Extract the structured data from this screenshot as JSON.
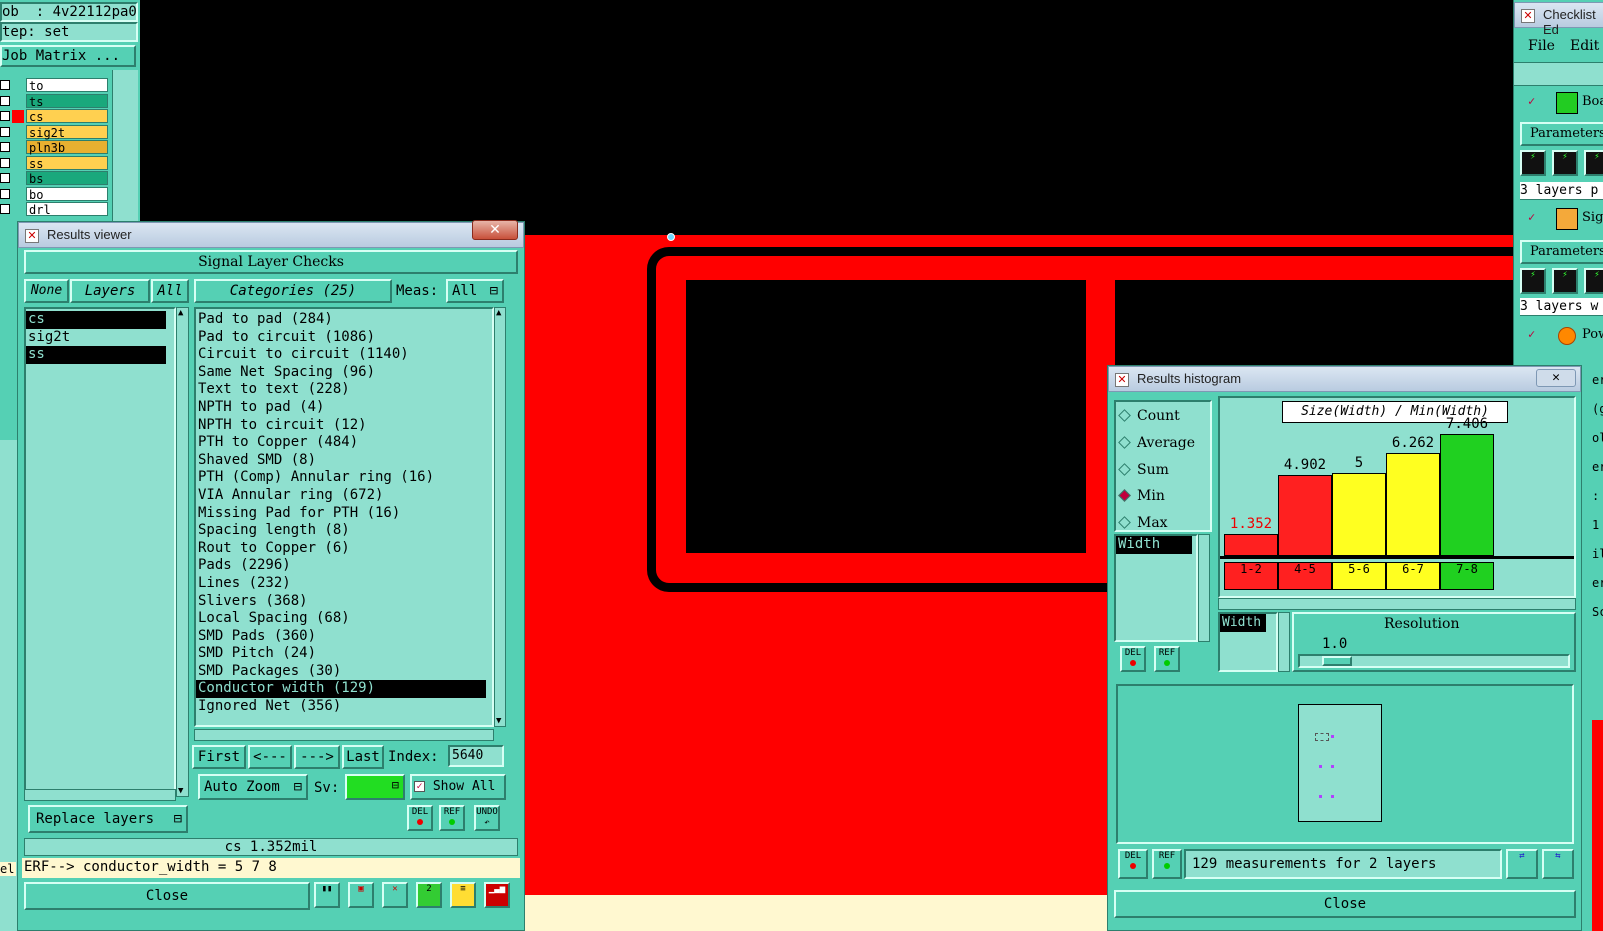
{
  "job_panel": {
    "job": "ob  : 4v22112pa0",
    "step": "tep: set",
    "matrix_button": "Job Matrix ...",
    "layers": [
      {
        "name": "to",
        "color": "#ffffff"
      },
      {
        "name": "ts",
        "color": "#1aa87c"
      },
      {
        "name": "cs",
        "color": "#ffd050"
      },
      {
        "name": "sig2t",
        "color": "#ffd050"
      },
      {
        "name": "pln3b",
        "color": "#e8b030"
      },
      {
        "name": "ss",
        "color": "#ffd050"
      },
      {
        "name": "bs",
        "color": "#1aa87c"
      },
      {
        "name": "bo",
        "color": "#ffffff"
      },
      {
        "name": "drl",
        "color": "#ffffff"
      }
    ],
    "left_edge_label": "el"
  },
  "results_viewer": {
    "title": "Results viewer",
    "section_title": "Signal Layer Checks",
    "none_label": "None",
    "layers_label": "Layers",
    "all_label": "All",
    "layer_list": [
      "cs",
      "sig2t",
      "ss"
    ],
    "selected_layers": [
      "cs",
      "ss"
    ],
    "categories_label": "Categories (25)",
    "meas_label": "Meas:",
    "meas_value": "All",
    "categories": [
      "Pad to pad (284)",
      "Pad to circuit (1086)",
      "Circuit to circuit (1140)",
      "Same Net Spacing (96)",
      "Text to text (228)",
      "NPTH to pad (4)",
      "NPTH to circuit (12)",
      "PTH to Copper (484)",
      "Shaved SMD (8)",
      "PTH (Comp) Annular ring (16)",
      "VIA Annular ring (672)",
      "Missing Pad for PTH (16)",
      "Spacing length (8)",
      "Rout to Copper (6)",
      "Pads (2296)",
      "Lines (232)",
      "Slivers (368)",
      "Local Spacing (68)",
      "SMD Pads (360)",
      "SMD Pitch (24)",
      "SMD Packages (30)",
      "Conductor width (129)",
      "Ignored Net (356)"
    ],
    "selected_category": "Conductor width (129)",
    "nav": {
      "first": "First",
      "prev": "<---",
      "next": "--->",
      "last": "Last",
      "index_label": "Index:",
      "index_value": "5640"
    },
    "auto_zoom": "Auto Zoom",
    "sv_label": "Sv:",
    "show_all": "Show All",
    "replace_layers": "Replace layers",
    "del": "DEL",
    "ref": "REF",
    "undo": "UNDO",
    "status": "cs 1.352mil",
    "erf_line": "ERF--> conductor_width = 5 7 8",
    "close": "Close"
  },
  "histogram": {
    "title": "Results histogram",
    "modes": [
      "Count",
      "Average",
      "Sum",
      "Min",
      "Max"
    ],
    "selected_mode": "Min",
    "measure_list": [
      "Width"
    ],
    "chart_title": "Size(Width) / Min(Width)",
    "resolution_label": "Resolution",
    "resolution_value": "1.0",
    "resolution_field": "Width",
    "summary": "129 measurements for 2 layers",
    "del": "DEL",
    "ref": "REF",
    "close": "Close"
  },
  "chart_data": {
    "type": "bar",
    "title": "Size(Width) / Min(Width)",
    "categories": [
      "1-2",
      "4-5",
      "5-6",
      "6-7",
      "7-8"
    ],
    "values": [
      1.352,
      4.902,
      5,
      6.262,
      7.406
    ],
    "value_labels": [
      "1.352",
      "4.902",
      "5",
      "6.262",
      "7.406"
    ],
    "colors": [
      "#ff2020",
      "#ff2020",
      "#ffff20",
      "#ffff20",
      "#20d020"
    ],
    "ylim": [
      0,
      8
    ],
    "grid": false
  },
  "checklist": {
    "title": "Checklist Ed",
    "menu": [
      "File",
      "Edit"
    ],
    "items": [
      {
        "label": "Boa",
        "sub": "Parameters",
        "layers": "3 layers p"
      },
      {
        "label": "Sign",
        "sub": "Parameters",
        "layers": "3 layers w"
      },
      {
        "label": "Pow",
        "sub": "",
        "layers": ""
      }
    ],
    "edge_labels": [
      "ers",
      "(g",
      "olo",
      "ers",
      ":",
      "1",
      "ilk",
      "ers",
      "Sc"
    ]
  },
  "colors": {
    "panel": "#55d0b4",
    "panel_light": "#8fe0cf",
    "copper_red": "#ff0000",
    "highlight_green": "#22dd22"
  }
}
